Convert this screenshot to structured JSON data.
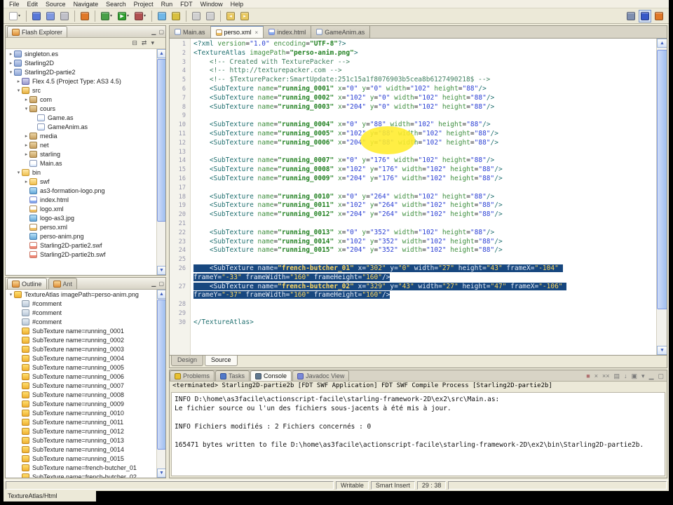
{
  "menu_bar": {
    "items": [
      "File",
      "Edit",
      "Source",
      "Navigate",
      "Search",
      "Project",
      "Run",
      "FDT",
      "Window",
      "Help"
    ]
  },
  "window_icons": [
    {
      "name": "minimize-icon",
      "glyph": "▁"
    },
    {
      "name": "maximize-icon",
      "glyph": "▢"
    }
  ],
  "toolbar": {
    "icons": [
      {
        "name": "new-wizard-icon",
        "color": "#ffffff",
        "drop": true
      },
      {
        "sep": true
      },
      {
        "name": "save-icon",
        "color": "#5878d8"
      },
      {
        "name": "save-all-icon",
        "color": "#8098e0"
      },
      {
        "name": "print-icon",
        "color": "#c0c0c8"
      },
      {
        "sep": true
      },
      {
        "name": "export-swf-icon",
        "color": "#e07828"
      },
      {
        "sep": true
      },
      {
        "name": "debug-icon",
        "color": "#48a048",
        "drop": true
      },
      {
        "name": "run-icon",
        "color": "#30a030",
        "glyph": "▶",
        "drop": true
      },
      {
        "name": "profile-icon",
        "color": "#b05050",
        "drop": true
      },
      {
        "sep": true
      },
      {
        "name": "new-as-class-icon",
        "color": "#70b8e8"
      },
      {
        "name": "search-icon",
        "color": "#d8c040"
      },
      {
        "sep": true
      },
      {
        "name": "prev-annotation-icon",
        "color": "#d0d0d0"
      },
      {
        "name": "next-annotation-icon",
        "color": "#d0d0d0"
      },
      {
        "sep": true
      },
      {
        "name": "back-icon",
        "color": "#e8c860",
        "glyph": "◂"
      },
      {
        "name": "forward-icon",
        "color": "#e8c860",
        "glyph": "▸"
      }
    ],
    "right_icons": [
      {
        "name": "open-perspective-icon",
        "color": "#8090b0"
      },
      {
        "name": "fdt-perspective-icon",
        "color": "#3858c8",
        "active": true
      },
      {
        "name": "flash-perspective-icon",
        "color": "#e07828"
      }
    ]
  },
  "flash_explorer": {
    "title": "Flash Explorer",
    "toolbar_icons": [
      {
        "name": "collapse-all-icon",
        "glyph": "⊟"
      },
      {
        "name": "link-with-editor-icon",
        "glyph": "⇄"
      },
      {
        "name": "view-menu-icon",
        "glyph": "▾"
      }
    ],
    "tree": [
      {
        "l": "singleton.es",
        "v": 0,
        "i": "project",
        "e": "c"
      },
      {
        "l": "Starling2D",
        "v": 0,
        "i": "project",
        "e": "c"
      },
      {
        "l": "Starling2D-partie2",
        "v": 0,
        "i": "project",
        "e": "o"
      },
      {
        "l": "Flex 4.5 (Project Type: AS3 4.5)",
        "v": 1,
        "i": "lib",
        "e": "c"
      },
      {
        "l": "src",
        "v": 1,
        "i": "srcfolder",
        "e": "o"
      },
      {
        "l": "com",
        "v": 2,
        "i": "package",
        "e": "c"
      },
      {
        "l": "cours",
        "v": 2,
        "i": "package",
        "e": "o"
      },
      {
        "l": "Game.as",
        "v": 3,
        "i": "as"
      },
      {
        "l": "GameAnim.as",
        "v": 3,
        "i": "as"
      },
      {
        "l": "media",
        "v": 2,
        "i": "package",
        "e": "c"
      },
      {
        "l": "net",
        "v": 2,
        "i": "package",
        "e": "c"
      },
      {
        "l": "starling",
        "v": 2,
        "i": "package",
        "e": "c"
      },
      {
        "l": "Main.as",
        "v": 2,
        "i": "as"
      },
      {
        "l": "bin",
        "v": 1,
        "i": "folder",
        "e": "o"
      },
      {
        "l": "swf",
        "v": 2,
        "i": "folder",
        "e": "c"
      },
      {
        "l": "as3-formation-logo.png",
        "v": 2,
        "i": "img"
      },
      {
        "l": "index.html",
        "v": 2,
        "i": "html"
      },
      {
        "l": "logo.xml",
        "v": 2,
        "i": "xml"
      },
      {
        "l": "logo-as3.jpg",
        "v": 2,
        "i": "img"
      },
      {
        "l": "perso.xml",
        "v": 2,
        "i": "xml"
      },
      {
        "l": "perso-anim.png",
        "v": 2,
        "i": "img"
      },
      {
        "l": "Starling2D-partie2.swf",
        "v": 2,
        "i": "swf"
      },
      {
        "l": "Starling2D-partie2b.swf",
        "v": 2,
        "i": "swf"
      }
    ]
  },
  "outline": {
    "tabs": [
      {
        "label": "Outline",
        "icon": "view",
        "active": true
      },
      {
        "label": "Ant",
        "icon": "view",
        "active": false
      }
    ],
    "tree": [
      {
        "l": "TextureAtlas imagePath=perso-anim.png",
        "v": 0,
        "i": "element",
        "e": "o"
      },
      {
        "l": "#comment",
        "v": 1,
        "i": "comment"
      },
      {
        "l": "#comment",
        "v": 1,
        "i": "comment"
      },
      {
        "l": "#comment",
        "v": 1,
        "i": "comment"
      },
      {
        "l": "SubTexture name=running_0001",
        "v": 1,
        "i": "element"
      },
      {
        "l": "SubTexture name=running_0002",
        "v": 1,
        "i": "element"
      },
      {
        "l": "SubTexture name=running_0003",
        "v": 1,
        "i": "element"
      },
      {
        "l": "SubTexture name=running_0004",
        "v": 1,
        "i": "element"
      },
      {
        "l": "SubTexture name=running_0005",
        "v": 1,
        "i": "element"
      },
      {
        "l": "SubTexture name=running_0006",
        "v": 1,
        "i": "element"
      },
      {
        "l": "SubTexture name=running_0007",
        "v": 1,
        "i": "element"
      },
      {
        "l": "SubTexture name=running_0008",
        "v": 1,
        "i": "element"
      },
      {
        "l": "SubTexture name=running_0009",
        "v": 1,
        "i": "element"
      },
      {
        "l": "SubTexture name=running_0010",
        "v": 1,
        "i": "element"
      },
      {
        "l": "SubTexture name=running_0011",
        "v": 1,
        "i": "element"
      },
      {
        "l": "SubTexture name=running_0012",
        "v": 1,
        "i": "element"
      },
      {
        "l": "SubTexture name=running_0013",
        "v": 1,
        "i": "element"
      },
      {
        "l": "SubTexture name=running_0014",
        "v": 1,
        "i": "element"
      },
      {
        "l": "SubTexture name=running_0015",
        "v": 1,
        "i": "element"
      },
      {
        "l": "SubTexture name=french-butcher_01",
        "v": 1,
        "i": "element"
      },
      {
        "l": "SubTexture name=french-butcher_02",
        "v": 1,
        "i": "element"
      }
    ]
  },
  "editor": {
    "tabs": [
      {
        "label": "Main.as",
        "icon": "as"
      },
      {
        "label": "perso.xml",
        "icon": "xml",
        "active": true
      },
      {
        "label": "index.html",
        "icon": "html"
      },
      {
        "label": "GameAnim.as",
        "icon": "as"
      }
    ],
    "bottom_tabs": [
      {
        "label": "Design"
      },
      {
        "label": "Source",
        "active": true
      }
    ],
    "lines": [
      {
        "n": 1,
        "t": "<?xml version=\"1.0\" encoding=\"UTF-8\"?>"
      },
      {
        "n": 2,
        "t": "<TextureAtlas imagePath=\"perso-anim.png\">"
      },
      {
        "n": 3,
        "t": "    <!-- Created with TexturePacker -->"
      },
      {
        "n": 4,
        "t": "    <!-- http://texturepacker.com -->"
      },
      {
        "n": 5,
        "t": "    <!-- $TexturePacker:SmartUpdate:251c15a1f8076903b5cea8b6127490218$ -->"
      },
      {
        "n": 6,
        "t": "    <SubTexture name=\"running_0001\" x=\"0\" y=\"0\" width=\"102\" height=\"88\"/>"
      },
      {
        "n": 7,
        "t": "    <SubTexture name=\"running_0002\" x=\"102\" y=\"0\" width=\"102\" height=\"88\"/>"
      },
      {
        "n": 8,
        "t": "    <SubTexture name=\"running_0003\" x=\"204\" y=\"0\" width=\"102\" height=\"88\"/>"
      },
      {
        "n": 9,
        "t": ""
      },
      {
        "n": 10,
        "t": "    <SubTexture name=\"running_0004\" x=\"0\" y=\"88\" width=\"102\" height=\"88\"/>"
      },
      {
        "n": 11,
        "t": "    <SubTexture name=\"running_0005\" x=\"102\" y=\"88\" width=\"102\" height=\"88\"/>"
      },
      {
        "n": 12,
        "t": "    <SubTexture name=\"running_0006\" x=\"204\" y=\"88\" width=\"102\" height=\"88\"/>"
      },
      {
        "n": 13,
        "t": ""
      },
      {
        "n": 14,
        "t": "    <SubTexture name=\"running_0007\" x=\"0\" y=\"176\" width=\"102\" height=\"88\"/>"
      },
      {
        "n": 15,
        "t": "    <SubTexture name=\"running_0008\" x=\"102\" y=\"176\" width=\"102\" height=\"88\"/>"
      },
      {
        "n": 16,
        "t": "    <SubTexture name=\"running_0009\" x=\"204\" y=\"176\" width=\"102\" height=\"88\"/>"
      },
      {
        "n": 17,
        "t": ""
      },
      {
        "n": 18,
        "t": "    <SubTexture name=\"running_0010\" x=\"0\" y=\"264\" width=\"102\" height=\"88\"/>"
      },
      {
        "n": 19,
        "t": "    <SubTexture name=\"running_0011\" x=\"102\" y=\"264\" width=\"102\" height=\"88\"/>"
      },
      {
        "n": 20,
        "t": "    <SubTexture name=\"running_0012\" x=\"204\" y=\"264\" width=\"102\" height=\"88\"/>"
      },
      {
        "n": 21,
        "t": ""
      },
      {
        "n": 22,
        "t": "    <SubTexture name=\"running_0013\" x=\"0\" y=\"352\" width=\"102\" height=\"88\"/>"
      },
      {
        "n": 23,
        "t": "    <SubTexture name=\"running_0014\" x=\"102\" y=\"352\" width=\"102\" height=\"88\"/>"
      },
      {
        "n": 24,
        "t": "    <SubTexture name=\"running_0015\" x=\"204\" y=\"352\" width=\"102\" height=\"88\"/>"
      },
      {
        "n": 25,
        "t": ""
      },
      {
        "n": 26,
        "sel": true,
        "t": "    <SubTexture name=\"french-butcher_01\" x=\"302\" y=\"0\" width=\"27\" height=\"43\" frameX=\"-104\" frameY=\"-33\" frameWidth=\"160\" frameHeight=\"160\"/>"
      },
      {
        "n": 27,
        "sel": true,
        "t": "    <SubTexture name=\"french-butcher_02\" x=\"329\" y=\"43\" width=\"27\" height=\"47\" frameX=\"-106\" frameY=\"-37\" frameWidth=\"160\" frameHeight=\"160\"/>"
      },
      {
        "n": 28,
        "t": ""
      },
      {
        "n": 29,
        "t": ""
      },
      {
        "n": 30,
        "t": "</TextureAtlas>"
      }
    ]
  },
  "console": {
    "tabs": [
      {
        "label": "Problems",
        "icon": "problems"
      },
      {
        "label": "Tasks",
        "icon": "tasks"
      },
      {
        "label": "Console",
        "icon": "console",
        "active": true
      },
      {
        "label": "Javadoc View",
        "icon": "javadoc"
      }
    ],
    "toolbar_icons": [
      {
        "name": "terminate-icon",
        "glyph": "■",
        "red": true
      },
      {
        "name": "remove-launch-icon",
        "glyph": "×"
      },
      {
        "name": "remove-all-launches-icon",
        "glyph": "××"
      },
      {
        "name": "clear-console-icon",
        "glyph": "▤"
      },
      {
        "name": "scroll-lock-icon",
        "glyph": "↓"
      },
      {
        "name": "pin-console-icon",
        "glyph": "▣"
      },
      {
        "name": "console-dropdown-icon",
        "glyph": "▾"
      },
      {
        "name": "minimize-icon",
        "glyph": "▁"
      },
      {
        "name": "maximize-icon",
        "glyph": "▢"
      }
    ],
    "header": "<terminated> Starling2D-partie2b [FDT SWF Application] FDT SWF Compile Process [Starling2D-partie2b]",
    "lines": [
      "INFO D:\\home\\as3facile\\actionscript-facile\\starling-framework-2D\\ex2\\src\\Main.as:",
      "Le fichier source ou l'un des fichiers sous-jacents à été mis à jour.",
      "",
      "INFO Fichiers modifiés : 2 Fichiers concernés : 0",
      "",
      "165471 bytes written to file D:\\home\\as3facile\\actionscript-facile\\starling-framework-2D\\ex2\\bin\\Starling2D-partie2b."
    ]
  },
  "status_bar": {
    "writable": "Writable",
    "insert_mode": "Smart Insert",
    "position": "29 : 38",
    "element_path": "TextureAtlas/Html"
  }
}
